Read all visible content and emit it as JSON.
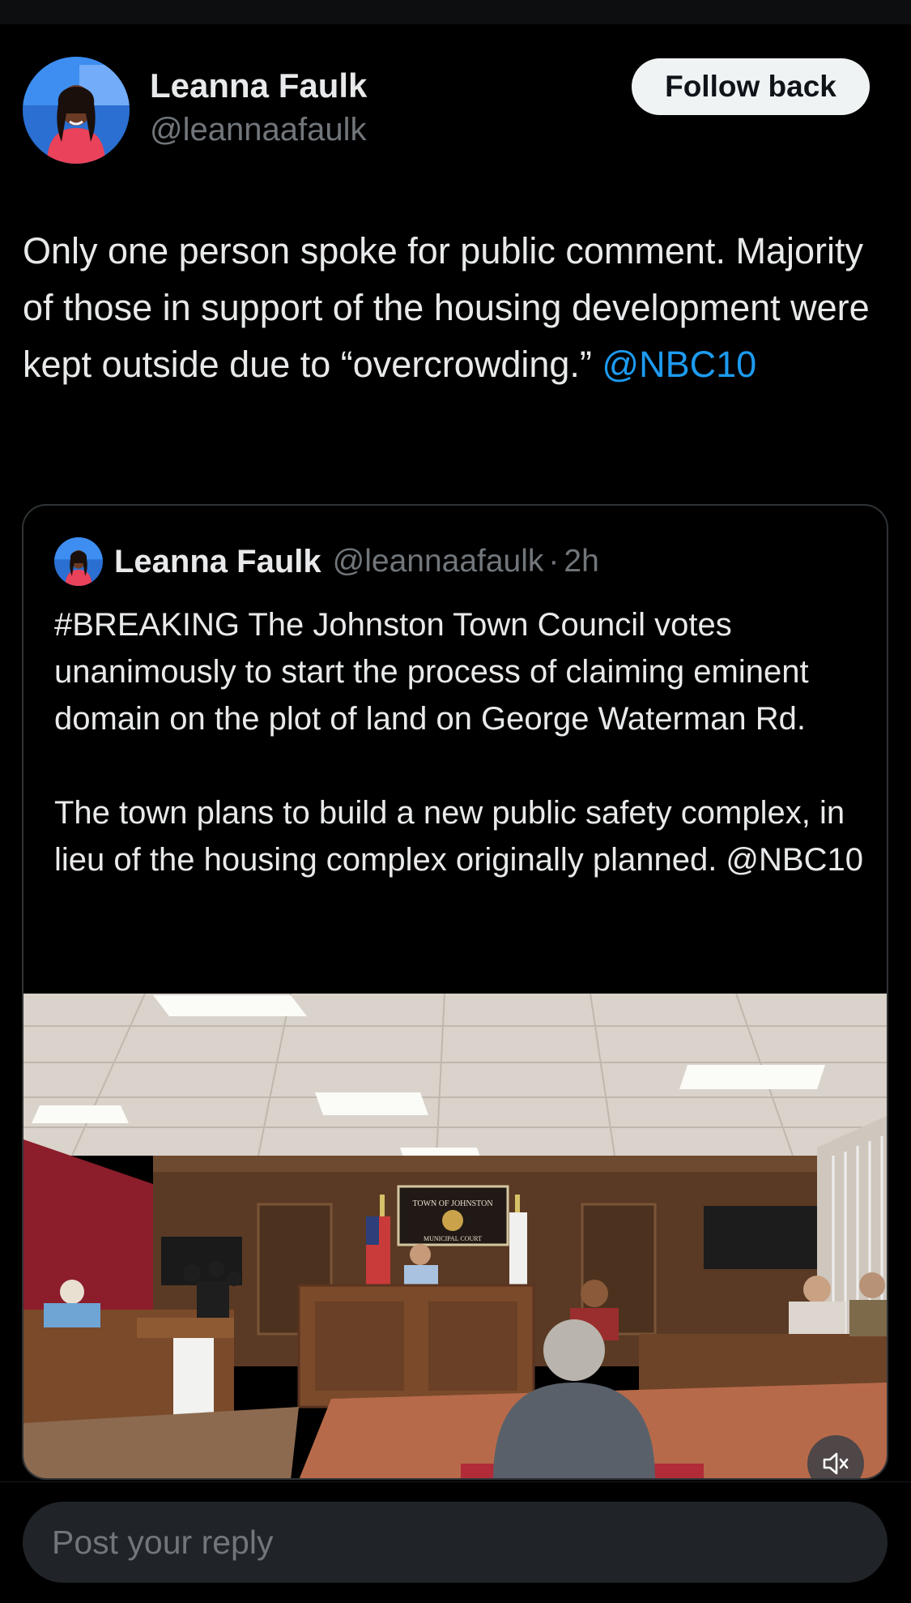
{
  "post": {
    "author_name": "Leanna Faulk",
    "author_handle": "@leannaafaulk",
    "follow_label": "Follow back",
    "text": "Only one person spoke for public comment. Majority of those in support of the housing development were kept outside due to “overcrowding.” ",
    "mention": "@NBC10"
  },
  "quoted_post": {
    "author_name": "Leanna Faulk",
    "author_handle": "@leannaafaulk",
    "separator": "·",
    "time": "2h",
    "paragraph_1": "#BREAKING The Johnston Town Council votes unanimously to start the process of claiming eminent domain on the plot of land on George Waterman Rd.",
    "paragraph_2": "The town plans to build a new public safety complex, in lieu of the housing complex originally planned. @NBC10",
    "media": {
      "seal_line_1": "TOWN OF JOHNSTON",
      "seal_line_2": "MUNICIPAL COURT",
      "mute_icon": "volume-muted-icon"
    }
  },
  "reply": {
    "placeholder": "Post your reply"
  },
  "colors": {
    "background": "#000000",
    "text": "#e7e9ea",
    "secondary_text": "#71767b",
    "link": "#1d9bf0",
    "border": "#2f3336",
    "follow_button_bg": "#eff3f4",
    "reply_input_bg": "#202327"
  }
}
